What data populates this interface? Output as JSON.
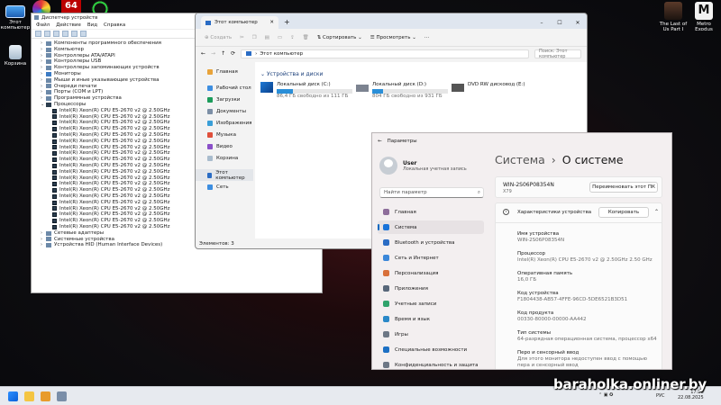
{
  "desktop": {
    "this_pc": "Этот компьютер",
    "recycle": "Корзина",
    "last_of_us": "The Last of Us Part I",
    "metro": "Metro Exodus",
    "gpu_z_label": "64"
  },
  "devmgr": {
    "title": "Диспетчер устройств",
    "menu": [
      "Файл",
      "Действие",
      "Вид",
      "Справка"
    ],
    "tree": [
      "Компоненты программного обеспечения",
      "Компьютер",
      "Контроллеры ATA/ATAPI",
      "Контроллеры USB",
      "Контроллеры запоминающих устройств",
      "Мониторы",
      "Мыши и иные указывающие устройства",
      "Очереди печати",
      "Порты (COM и LPT)",
      "Программные устройства",
      "Процессоры"
    ],
    "cpu": "Intel(R) Xeon(R) CPU E5-2670 v2 @ 2.50GHz",
    "tree_after": [
      "Сетевые адаптеры",
      "Системные устройства",
      "Устройства HID (Human Interface Devices)"
    ]
  },
  "explorer": {
    "tab": "Этот компьютер",
    "cmd": {
      "create": "Создать",
      "sort": "Сортировать",
      "view": "Просмотреть"
    },
    "address": "Этот компьютер",
    "search": "Поиск: Этот компьютер",
    "nav": [
      "Главная",
      "Рабочий стол",
      "Загрузки",
      "Документы",
      "Изображения",
      "Музыка",
      "Видео",
      "Корзина",
      "Этот компьютер",
      "Сеть"
    ],
    "section": "Устройства и диски",
    "drives": [
      {
        "name": "Локальный диск (C:)",
        "free": "86,4 ГБ свободно из 111 ГБ",
        "used": 0.22
      },
      {
        "name": "Локальный диск (D:)",
        "free": "804 ГБ свободно из 931 ГБ",
        "used": 0.14
      },
      {
        "name": "DVD RW дисковод (E:)",
        "free": "",
        "used": 0
      }
    ],
    "status": "Элементов: 3"
  },
  "settings": {
    "title": "Параметры",
    "user": "User",
    "user_sub": "Локальная учетная запись",
    "find": "Найти параметр",
    "nav": [
      "Главная",
      "Система",
      "Bluetooth и устройства",
      "Сеть и Интернет",
      "Персонализация",
      "Приложения",
      "Учетные записи",
      "Время и язык",
      "Игры",
      "Специальные возможности",
      "Конфиденциальность и защита"
    ],
    "breadcrumb_a": "Система",
    "breadcrumb_sep": "›",
    "breadcrumb_b": "О системе",
    "pc_name": "WIN-2S06P08354N",
    "pc_model": "X79",
    "rename": "Переименовать этот ПК",
    "specs_title": "Характеристики устройства",
    "copy": "Копировать",
    "specs": [
      {
        "k": "Имя устройства",
        "v": "WIN-2S06P08354N"
      },
      {
        "k": "Процессор",
        "v": "Intel(R) Xeon(R) CPU E5-2670 v2 @ 2.50GHz   2.50 GHz"
      },
      {
        "k": "Оперативная память",
        "v": "16,0 ГБ"
      },
      {
        "k": "Код устройства",
        "v": "F1804438-AB57-4FFE-96CD-5DE6521B3D51"
      },
      {
        "k": "Код продукта",
        "v": "00330-80000-00000-AA442"
      },
      {
        "k": "Тип системы",
        "v": "64-разрядная операционная система, процессор x64"
      },
      {
        "k": "Перо и сенсорный ввод",
        "v": "Для этого монитора недоступен ввод с помощью пера и сенсорный ввод"
      }
    ]
  },
  "taskbar": {
    "lang": "РУС",
    "time": "17:26",
    "date": "22.08.2025"
  },
  "watermark": "baraholka.onliner.by"
}
